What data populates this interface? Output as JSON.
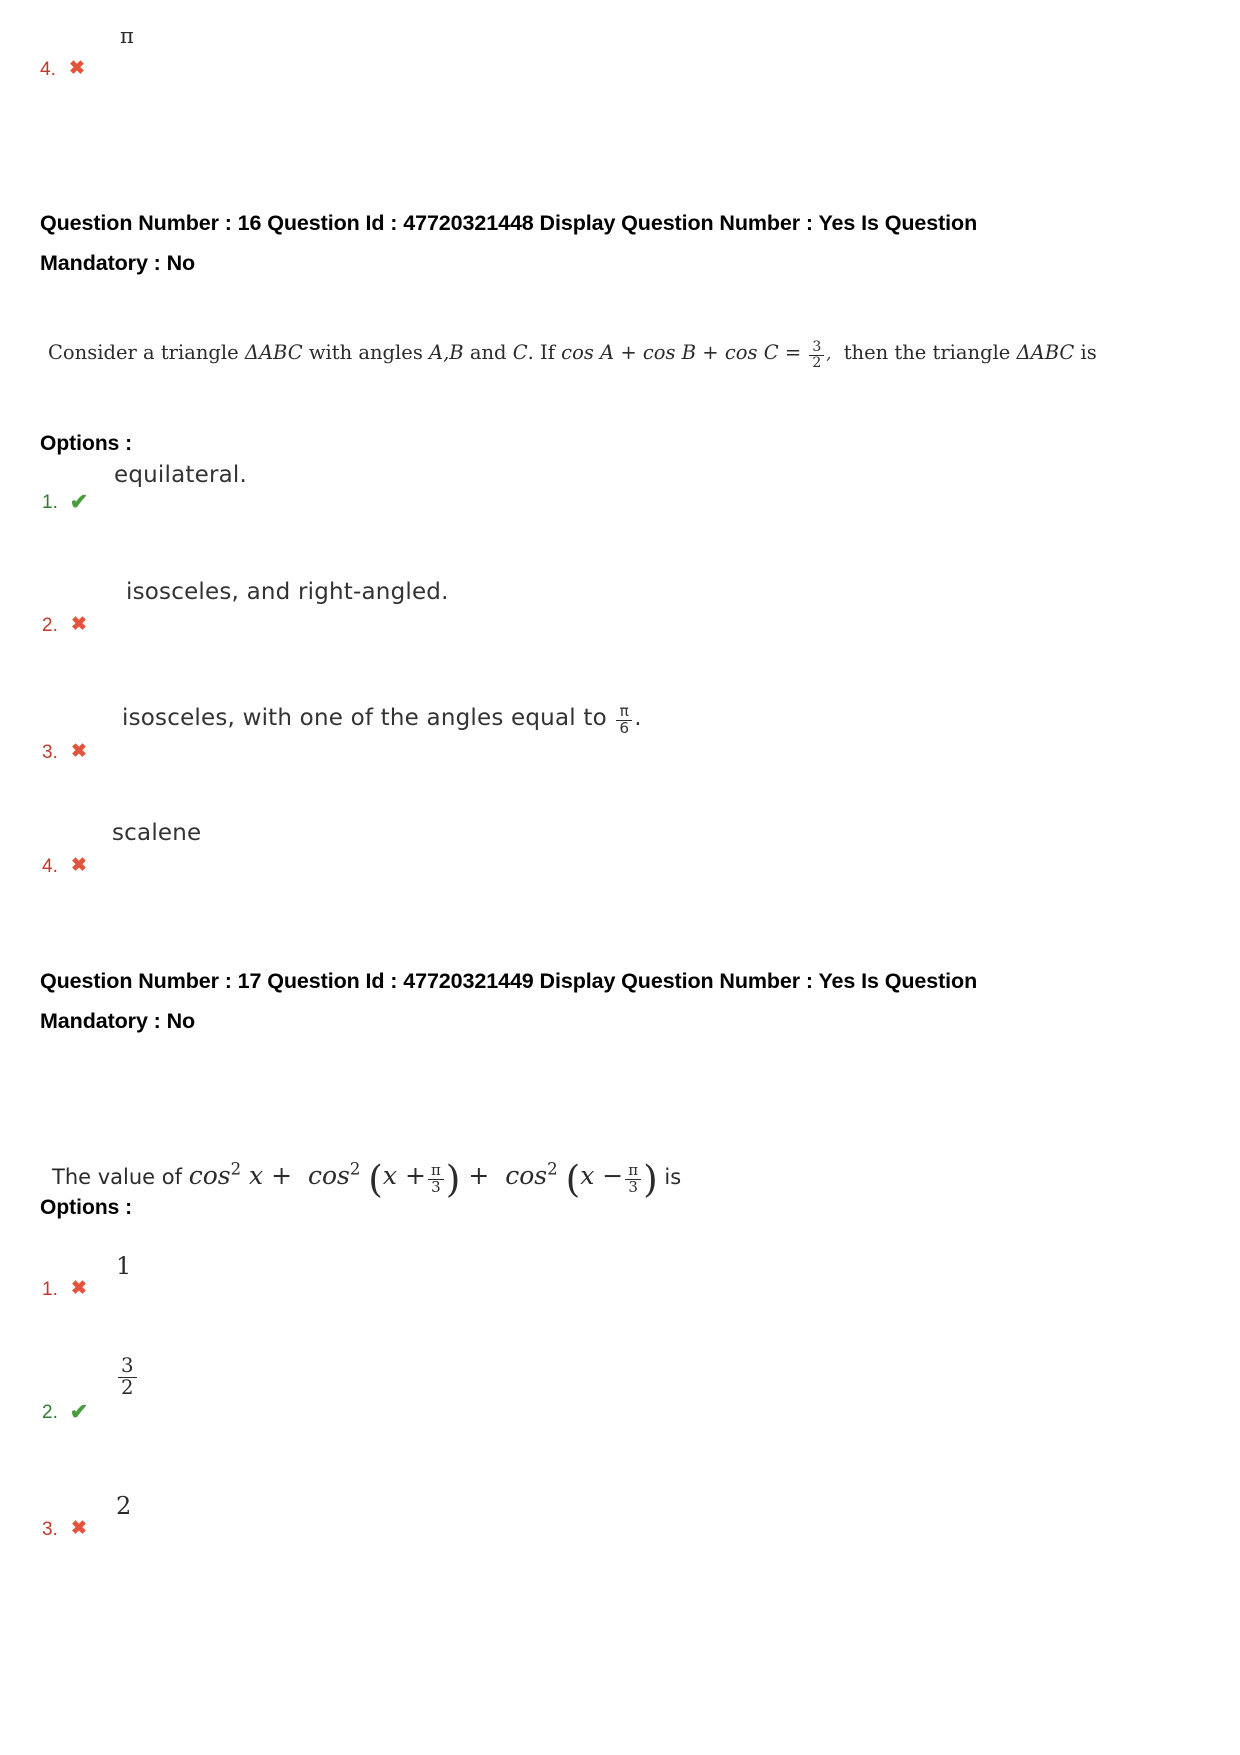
{
  "previous_question_tail": {
    "option_number": "4.",
    "mark": "cross",
    "text": "π"
  },
  "questions": [
    {
      "header": "Question Number : 16 Question Id : 47720321448 Display Question Number : Yes Is Question Mandatory : No",
      "header_line1": "Question Number : 16 Question Id : 47720321448 Display Question Number : Yes Is Question",
      "header_line2": "Mandatory : No",
      "question_number": "16",
      "question_id": "47720321448",
      "display_question_number": "Yes",
      "is_question_mandatory": "No",
      "stem_text": "Consider a triangle ΔABC with angles A,B and C. If cos A + cos B + cos C = 3/2, then the triangle ΔABC is",
      "stem_parts": {
        "p1": "Consider a triangle ",
        "tri1": "ΔABC",
        "p2": " with angles ",
        "angles": "A,B",
        "p3": " and ",
        "angleC": "C",
        "p4": ". If ",
        "cosA": "cos A",
        "plus1": " + ",
        "cosB": "cos B",
        "plus2": " + ",
        "cosC": "cos C",
        "eq": " = ",
        "frac_num": "3",
        "frac_den": "2",
        "comma": ",",
        "p5": "then the triangle ",
        "tri2": "ΔABC",
        "p6": " is"
      },
      "options_label": "Options :",
      "options": [
        {
          "number": "1.",
          "mark": "tick",
          "text": "equilateral."
        },
        {
          "number": "2.",
          "mark": "cross",
          "text": "isosceles, and right-angled."
        },
        {
          "number": "3.",
          "mark": "cross",
          "text_before": "isosceles, with one of the angles equal to ",
          "frac_num": "π",
          "frac_den": "6",
          "text_after": ".",
          "text": "isosceles, with one of the angles equal to π/6."
        },
        {
          "number": "4.",
          "mark": "cross",
          "text": "scalene"
        }
      ]
    },
    {
      "header": "Question Number : 17 Question Id : 47720321449 Display Question Number : Yes Is Question Mandatory : No",
      "header_line1": "Question Number : 17 Question Id : 47720321449 Display Question Number : Yes Is Question",
      "header_line2": "Mandatory : No",
      "question_number": "17",
      "question_id": "47720321449",
      "display_question_number": "Yes",
      "is_question_mandatory": "No",
      "stem_text": "The value of cos² x + cos² (x + π/3) + cos² (x − π/3) is",
      "stem_parts": {
        "p1": "The value of ",
        "cos1": "cos",
        "sup1": "2",
        "x1": "x",
        "plus1": " + ",
        "cos2": "cos",
        "sup2": "2",
        "x2": "x",
        "op2": " +",
        "f2_num": "π",
        "f2_den": "3",
        "plus2": " + ",
        "cos3": "cos",
        "sup3": "2",
        "x3": "x",
        "op3": " −",
        "f3_num": "π",
        "f3_den": "3",
        "p2": " is"
      },
      "options_label": "Options :",
      "options": [
        {
          "number": "1.",
          "mark": "cross",
          "text": "1"
        },
        {
          "number": "2.",
          "mark": "tick",
          "frac_num": "3",
          "frac_den": "2",
          "text": "3/2"
        },
        {
          "number": "3.",
          "mark": "cross",
          "text": "2"
        }
      ]
    }
  ],
  "glyphs": {
    "cross": "✖",
    "tick": "✔"
  },
  "colors": {
    "cross": "#e2553c",
    "tick": "#4a9d3f",
    "option_number_wrong": "#c0392b",
    "option_number_correct": "#2e7d32",
    "text": "#1a1a1a",
    "page_background": "#ffffff"
  }
}
